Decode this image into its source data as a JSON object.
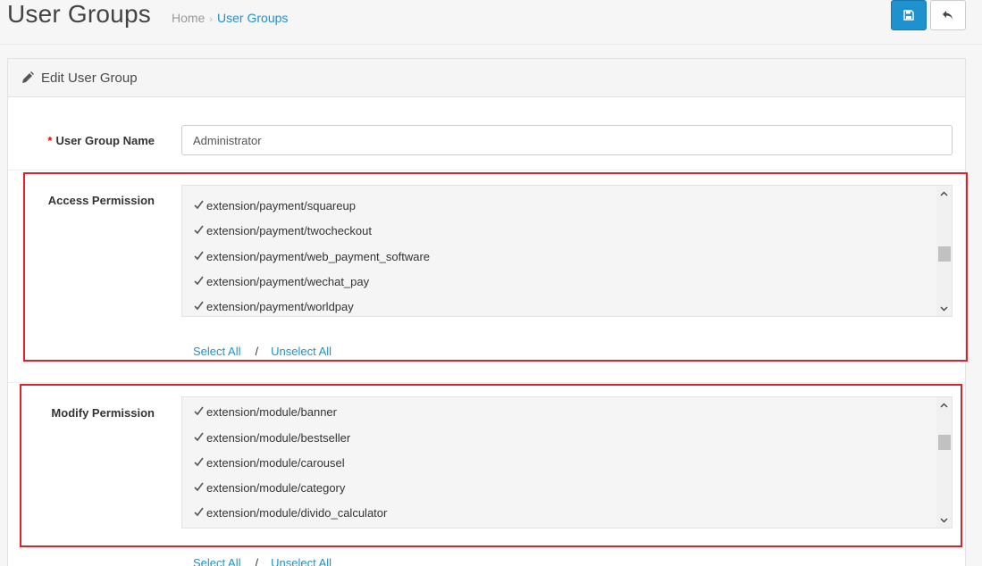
{
  "header": {
    "title": "User Groups",
    "breadcrumb": {
      "home": "Home",
      "separator": "›",
      "current": "User Groups"
    }
  },
  "toolbar": {
    "save_icon": "save-icon",
    "back_icon": "reply-icon"
  },
  "panel": {
    "title": "Edit User Group",
    "icon": "pencil-icon"
  },
  "form": {
    "name_label": "User Group Name",
    "required_mark": "*",
    "name_value": "Administrator",
    "access": {
      "label": "Access Permission",
      "items": [
        "extension/payment/squareup",
        "extension/payment/twocheckout",
        "extension/payment/web_payment_software",
        "extension/payment/wechat_pay",
        "extension/payment/worldpay"
      ],
      "select_all": "Select All",
      "separator": "/",
      "unselect_all": "Unselect All"
    },
    "modify": {
      "label": "Modify Permission",
      "items": [
        "extension/module/banner",
        "extension/module/bestseller",
        "extension/module/carousel",
        "extension/module/category",
        "extension/module/divido_calculator"
      ],
      "select_all": "Select All",
      "separator": "/",
      "unselect_all": "Unselect All"
    }
  },
  "colors": {
    "primary": "#1e91cf",
    "highlight": "#e0202a",
    "required": "#ff0000"
  }
}
